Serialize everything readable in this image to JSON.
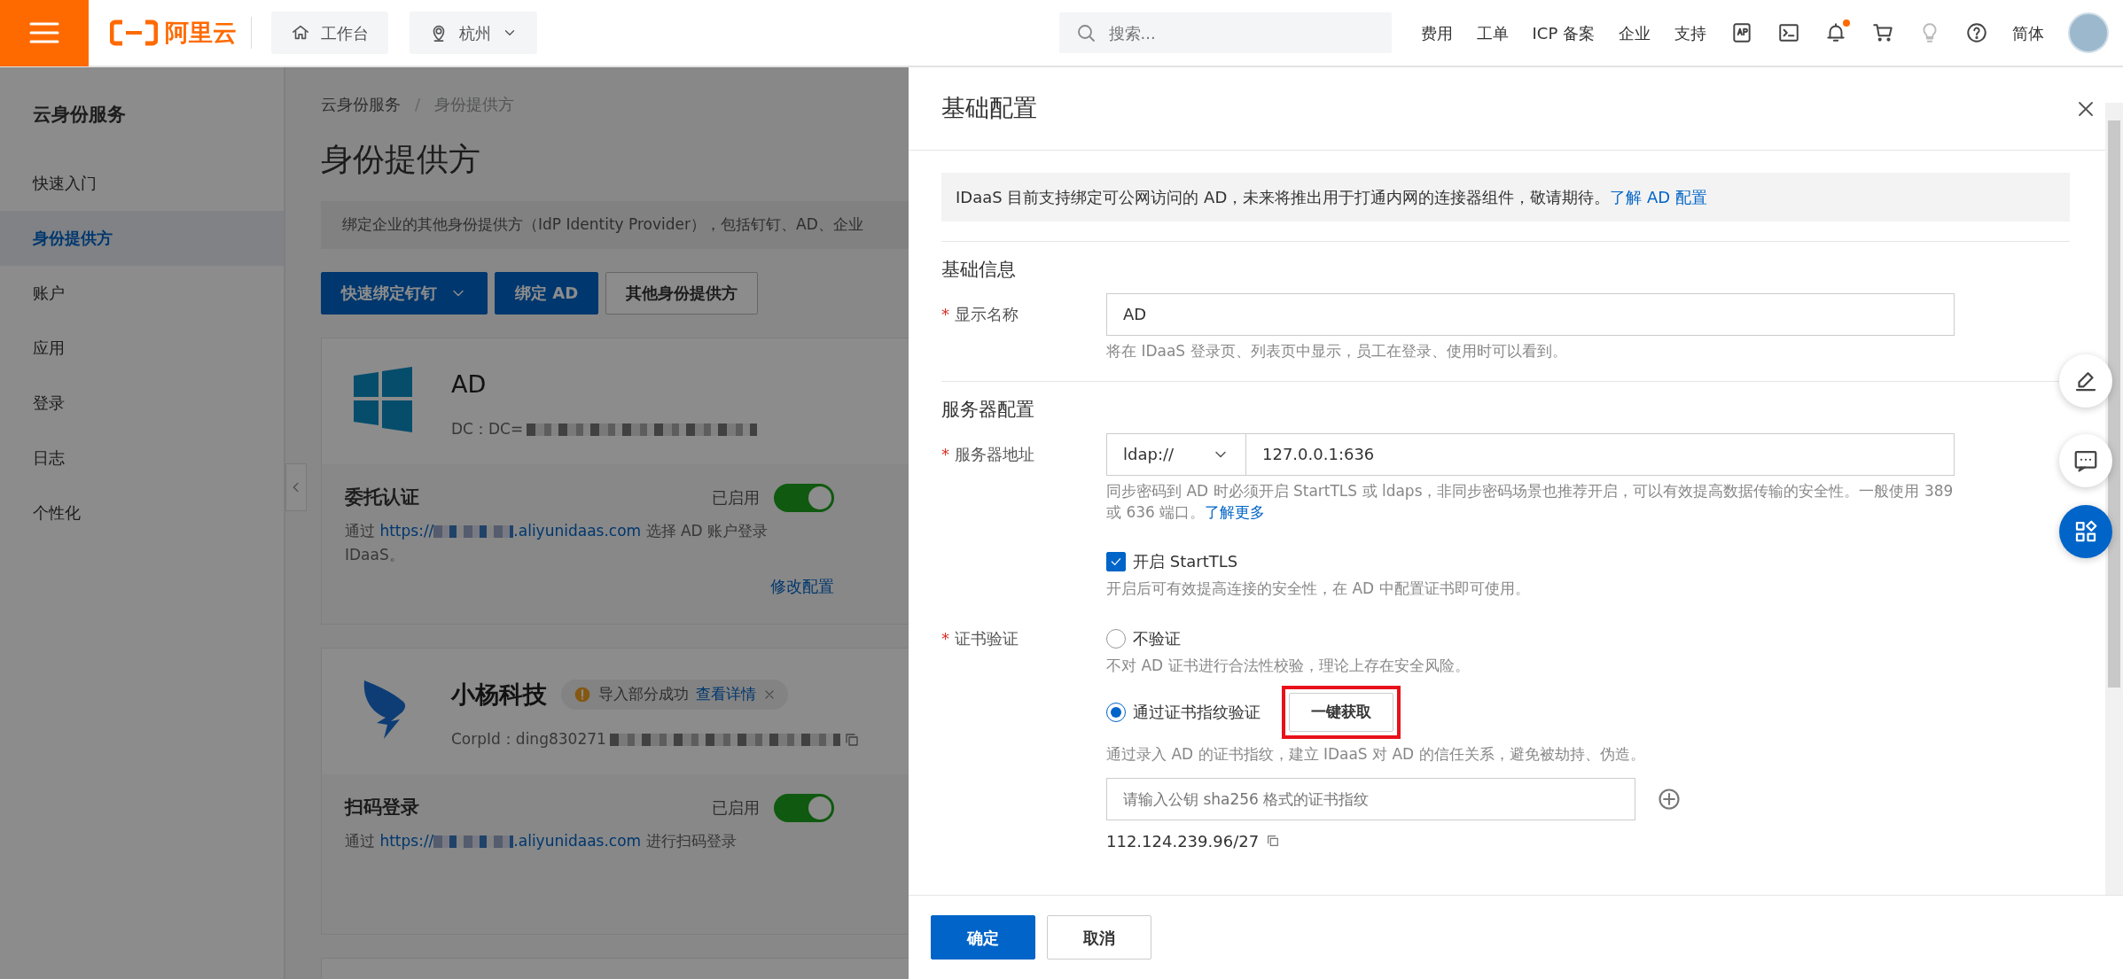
{
  "topbar": {
    "logo_text": "阿里云",
    "workbench": "工作台",
    "region": "杭州",
    "search": {
      "placeholder": "搜索..."
    },
    "links": [
      "费用",
      "工单",
      "ICP 备案",
      "企业",
      "支持"
    ],
    "tools": [
      {
        "kind": "app"
      },
      {
        "kind": "terminal"
      },
      {
        "kind": "bell",
        "dot": true
      },
      {
        "kind": "cart"
      },
      {
        "kind": "bulb"
      },
      {
        "kind": "help"
      }
    ],
    "language": "简体"
  },
  "sidebar": {
    "title": "云身份服务",
    "items": [
      {
        "label": "快速入门",
        "selected": false
      },
      {
        "label": "身份提供方",
        "selected": true
      },
      {
        "label": "账户",
        "selected": false
      },
      {
        "label": "应用",
        "selected": false
      },
      {
        "label": "登录",
        "selected": false
      },
      {
        "label": "日志",
        "selected": false
      },
      {
        "label": "个性化",
        "selected": false
      }
    ]
  },
  "main": {
    "breadcrumb": {
      "items": [
        "云身份服务",
        "身份提供方"
      ],
      "separator": "/"
    },
    "title": "身份提供方",
    "notice": "绑定企业的其他身份提供方（IdP Identity Provider），包括钉钉、AD、企业",
    "buttons": [
      {
        "label": "快速绑定钉钉",
        "kind": "dropdown"
      },
      {
        "label": "绑定 AD",
        "kind": "primary"
      },
      {
        "label": "其他身份提供方",
        "kind": "default"
      }
    ],
    "providers": [
      {
        "kind": "windows",
        "name": "AD",
        "meta_label": "DC：",
        "meta_value": "DC=",
        "copyable": false,
        "feature": {
          "title": "委托认证",
          "status": "已启用",
          "enabled": true,
          "text_before": "通过",
          "url_prefix": "https://",
          "url_suffix": ".aliyunidaas.com",
          "text_after": "选择 AD 账户登录 IDaaS。",
          "action": "修改配置"
        }
      },
      {
        "kind": "dingtalk",
        "name": "小杨科技",
        "badge": {
          "text": "导入部分成功",
          "link": "查看详情"
        },
        "meta_label": "CorpId：",
        "meta_value": "ding830271",
        "copyable": true,
        "feature": {
          "title": "扫码登录",
          "status": "已启用",
          "enabled": true,
          "text_before": "通过",
          "url_prefix": "https://",
          "url_suffix": ".aliyunidaas.com",
          "text_after": "进行扫码登录"
        }
      }
    ]
  },
  "drawer": {
    "title": "基础配置",
    "notice": {
      "text": "IDaaS 目前支持绑定可公网访问的 AD，未来将推出用于打通内网的连接器组件，敬请期待。",
      "link": "了解 AD 配置"
    },
    "basic": {
      "heading": "基础信息",
      "label": "显示名称",
      "required_mark": "*",
      "value": "AD",
      "hint": "将在 IDaaS 登录页、列表页中显示，员工在登录、使用时可以看到。"
    },
    "server": {
      "heading": "服务器配置",
      "label": "服务器地址",
      "required_mark": "*",
      "protocol": "ldap://",
      "value": "127.0.0.1:636",
      "hint": "同步密码到 AD 时必须开启 StartTLS 或 ldaps，非同步密码场景也推荐开启，可以有效提高数据传输的安全性。一般使用 389 或 636 端口。",
      "hint_link": "了解更多",
      "starttls": {
        "label": "开启 StartTLS",
        "checked": true,
        "hint": "开启后可有效提高连接的安全性，在 AD 中配置证书即可使用。"
      }
    },
    "cert": {
      "label": "证书验证",
      "required_mark": "*",
      "options": [
        {
          "label": "不验证",
          "selected": false,
          "hint": "不对 AD 证书进行合法性校验，理论上存在安全风险。"
        },
        {
          "label": "通过证书指纹验证",
          "selected": true,
          "hint": "通过录入 AD 的证书指纹，建立 IDaaS 对 AD 的信任关系，避免被劫持、伪造。",
          "action": {
            "label": "一键获取",
            "highlighted": true
          }
        }
      ],
      "fingerprint": {
        "placeholder": "请输入公钥 sha256 格式的证书指纹"
      }
    },
    "ip_text": "112.124.239.96/27",
    "buttons": [
      {
        "label": "确定",
        "kind": "primary"
      },
      {
        "label": "取消",
        "kind": "default"
      }
    ]
  }
}
